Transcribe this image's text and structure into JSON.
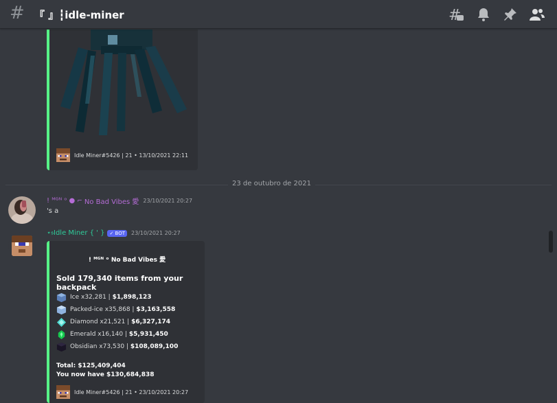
{
  "header": {
    "hash": "#",
    "channel_name": "『 』┇idle-miner"
  },
  "prev_embed": {
    "footer": "Idle Miner#5426 | 21 • 13/10/2021 22:11"
  },
  "divider": {
    "label": "23 de outubro de 2021"
  },
  "user_message": {
    "prefix": "! ᴹᴳᴺ ᵒ",
    "username": "No Bad Vibes 愛",
    "timestamp": "23/10/2021 20:27",
    "text": "'s a"
  },
  "bot_message": {
    "username": "⋆𝔰Idle Miner { ' }",
    "badge": "✓ BOT",
    "timestamp": "23/10/2021 20:27",
    "embed": {
      "author": "! ᴹᴳᴺ ᵒ No Bad Vibes 愛",
      "title": "Sold 179,340 items from your backpack",
      "items": [
        {
          "name": "Ice x32,281 |",
          "value": "$1,898,123",
          "color": "#5b7fb8",
          "icon": "ice-block-icon"
        },
        {
          "name": "Packed-ice x35,868 |",
          "value": "$3,163,558",
          "color": "#8fb3e0",
          "icon": "packed-ice-block-icon"
        },
        {
          "name": "Diamond x21,521 |",
          "value": "$6,327,174",
          "color": "#4fd8d0",
          "icon": "diamond-icon"
        },
        {
          "name": "Emerald x16,140 |",
          "value": "$5,931,450",
          "color": "#17c94f",
          "icon": "emerald-icon"
        },
        {
          "name": "Obsidian x73,530 |",
          "value": "$108,089,100",
          "color": "#1a1526",
          "icon": "obsidian-block-icon"
        }
      ],
      "total": "Total: $125,409,404",
      "now_have": "You now have $130,684,838",
      "footer": "Idle Miner#5426 | 21 • 23/10/2021 20:27"
    }
  },
  "colors": {
    "background": "#36393f",
    "embed_bg": "#2f3136",
    "embed_border": "#57f287",
    "bot_badge": "#5865f2"
  }
}
